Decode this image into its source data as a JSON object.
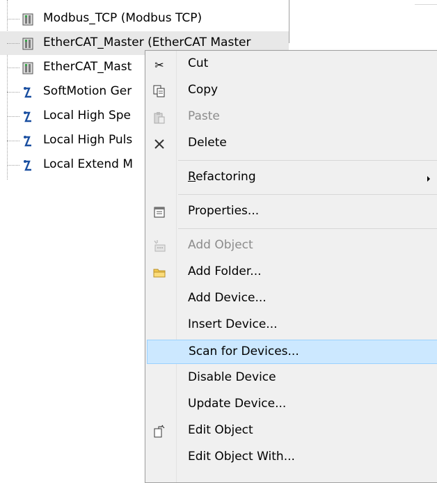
{
  "tree": {
    "items": [
      {
        "label": "Modbus_TCP (Modbus TCP)",
        "icon": "device-icon"
      },
      {
        "label": "EtherCAT_Master (EtherCAT Master",
        "icon": "device-icon"
      },
      {
        "label": "EtherCAT_Mast",
        "icon": "device-icon"
      },
      {
        "label": "SoftMotion Ger",
        "icon": "axis-icon"
      },
      {
        "label": "Local High Spe",
        "icon": "axis-icon"
      },
      {
        "label": "Local High Puls",
        "icon": "axis-icon"
      },
      {
        "label": "Local Extend M",
        "icon": "axis-icon"
      }
    ]
  },
  "context_menu": {
    "items": [
      {
        "label": "Cut",
        "icon": "scissors-icon",
        "disabled": false
      },
      {
        "label": "Copy",
        "icon": "copy-icon",
        "disabled": false
      },
      {
        "label": "Paste",
        "icon": "paste-icon",
        "disabled": true
      },
      {
        "label": "Delete",
        "icon": "delete-icon",
        "disabled": false
      },
      {
        "label_underline": "R",
        "label_rest": "efactoring",
        "icon": "",
        "submenu": true
      },
      {
        "label": "Properties...",
        "icon": "properties-icon",
        "disabled": false
      },
      {
        "label": "Add Object",
        "icon": "add-object-icon",
        "disabled": true
      },
      {
        "label": "Add Folder...",
        "icon": "folder-icon",
        "disabled": false
      },
      {
        "label": "Add Device...",
        "icon": "",
        "disabled": false
      },
      {
        "label": "Insert Device...",
        "icon": "",
        "disabled": false
      },
      {
        "label": "Scan for Devices...",
        "icon": "",
        "disabled": false,
        "highlighted": true
      },
      {
        "label": "Disable Device",
        "icon": "",
        "disabled": false
      },
      {
        "label": "Update Device...",
        "icon": "",
        "disabled": false
      },
      {
        "label": "Edit Object",
        "icon": "edit-object-icon",
        "disabled": false
      },
      {
        "label": "Edit Object With...",
        "icon": "",
        "disabled": false
      }
    ]
  },
  "colors": {
    "highlight_bg": "#cce8ff",
    "highlight_border": "#99d1ff",
    "menu_bg": "#f0f0f0",
    "disabled_text": "#8c8c8c"
  }
}
